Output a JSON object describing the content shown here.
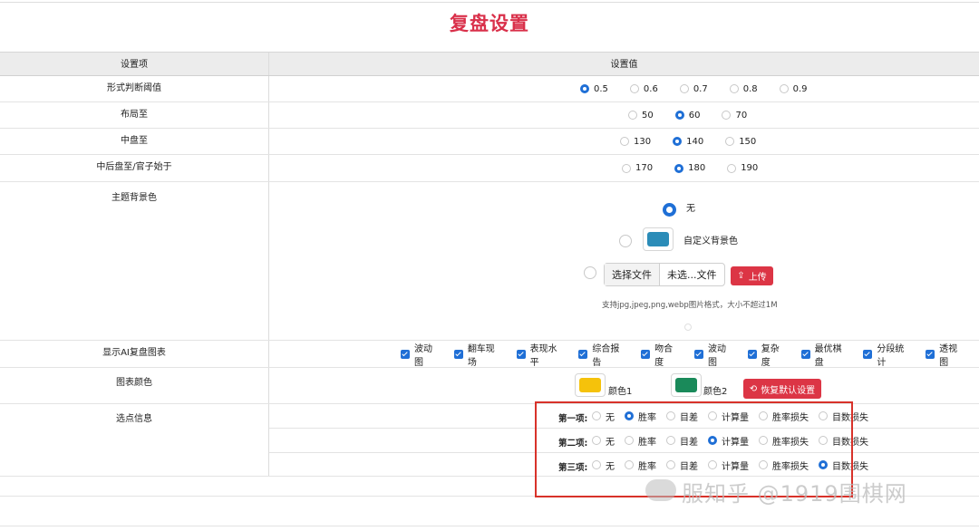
{
  "title": "复盘设置",
  "header": {
    "col1": "设置项",
    "col2": "设置值"
  },
  "threshold": {
    "label": "形式判断阈值",
    "options": [
      "0.5",
      "0.6",
      "0.7",
      "0.8",
      "0.9"
    ],
    "selected": "0.5"
  },
  "opening": {
    "label": "布局至",
    "options": [
      "50",
      "60",
      "70"
    ],
    "selected": "60"
  },
  "midgame": {
    "label": "中盘至",
    "options": [
      "130",
      "140",
      "150"
    ],
    "selected": "140"
  },
  "endgame": {
    "label": "中后盘至/官子始于",
    "options": [
      "170",
      "180",
      "190"
    ],
    "selected": "180"
  },
  "theme_bg": {
    "label": "主题背景色",
    "none_label": "无",
    "custom_label": "自定义背景色",
    "custom_color": "#2b8cb8",
    "choose_file": "选择文件",
    "no_file": "未选...文件",
    "upload": "上传",
    "hint": "支持jpg,jpeg,png,webp图片格式，大小不超过1M"
  },
  "ai_charts": {
    "label": "显示AI复盘图表",
    "items": [
      "波动图",
      "翻车现场",
      "表现水平",
      "综合报告",
      "吻合度",
      "波动图",
      "复杂度",
      "最优棋盘",
      "分段统计",
      "透视图"
    ]
  },
  "chart_color": {
    "label": "图表颜色",
    "color1_label": "颜色1",
    "color1": "#f5c20b",
    "color2_label": "颜色2",
    "color2": "#1a8a5a",
    "reset": "恢复默认设置"
  },
  "point_info": {
    "label": "选点信息",
    "rows": [
      {
        "name": "第一项:",
        "options": [
          "无",
          "胜率",
          "目差",
          "计算量",
          "胜率损失",
          "目数损失"
        ],
        "selected": 1
      },
      {
        "name": "第二项:",
        "options": [
          "无",
          "胜率",
          "目差",
          "计算量",
          "胜率损失",
          "目数损失"
        ],
        "selected": 3
      },
      {
        "name": "第三项:",
        "options": [
          "无",
          "胜率",
          "目差",
          "计算量",
          "胜率损失",
          "目数损失"
        ],
        "selected": 5
      }
    ]
  },
  "watermark": "服知乎 @1919围棋网"
}
